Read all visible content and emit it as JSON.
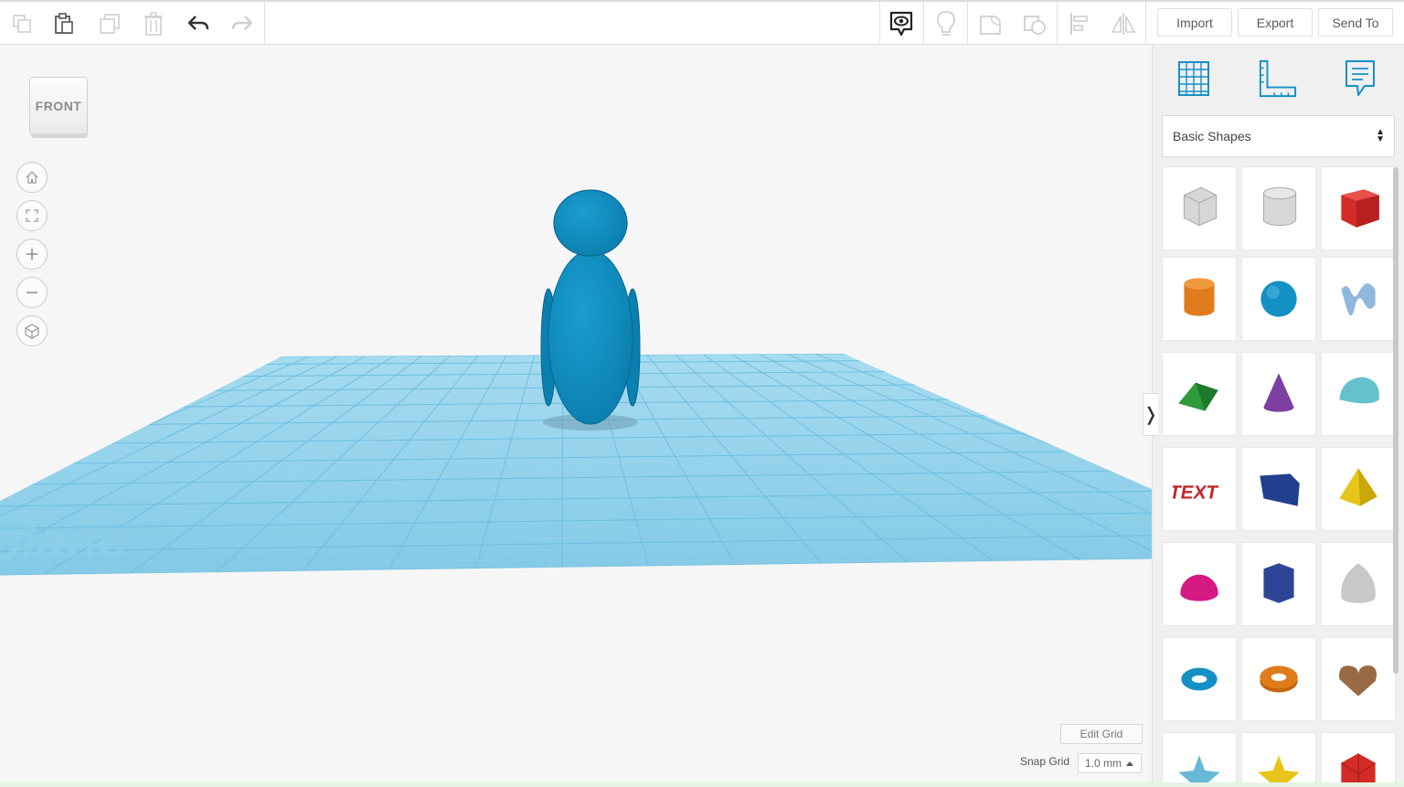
{
  "toolbar": {
    "buttons": [
      {
        "name": "copy",
        "icon": "copy-icon"
      },
      {
        "name": "paste",
        "icon": "paste-icon"
      },
      {
        "name": "duplicate",
        "icon": "duplicate-icon"
      },
      {
        "name": "delete",
        "icon": "trash-icon"
      },
      {
        "name": "undo",
        "icon": "undo-icon"
      },
      {
        "name": "redo",
        "icon": "redo-icon"
      }
    ],
    "view_tools": [
      "show-all-icon",
      "lightbulb-icon",
      "group-icon",
      "ungroup-icon",
      "align-icon",
      "mirror-icon"
    ],
    "import_label": "Import",
    "export_label": "Export",
    "send_to_label": "Send To"
  },
  "viewcube": {
    "face_label": "FRONT"
  },
  "navigation": [
    "home-icon",
    "fit-view-icon",
    "zoom-in-icon",
    "zoom-out-icon",
    "perspective-icon"
  ],
  "workplane": {
    "watermark": "Workplane",
    "grid_color": "#5bb8dc",
    "object_color": "#0e8fc2"
  },
  "grid_controls": {
    "edit_grid_label": "Edit Grid",
    "snap_grid_label": "Snap Grid",
    "snap_value": "1.0 mm"
  },
  "panel": {
    "tabs": [
      "workplane-grid-icon",
      "ruler-icon",
      "notes-icon"
    ],
    "library": "Basic Shapes",
    "shapes": [
      {
        "name": "box-hole",
        "color": "#b8b8b8"
      },
      {
        "name": "cylinder-hole",
        "color": "#b8b8b8"
      },
      {
        "name": "box",
        "color": "#d32c27"
      },
      {
        "name": "cylinder",
        "color": "#e07c1c"
      },
      {
        "name": "sphere",
        "color": "#1391c4"
      },
      {
        "name": "scribble",
        "color": "#8fb9dc"
      },
      {
        "name": "roof",
        "color": "#2f9a3c"
      },
      {
        "name": "cone",
        "color": "#7c3fa0"
      },
      {
        "name": "round-roof",
        "color": "#66c1cf"
      },
      {
        "name": "text",
        "color": "#c1272d"
      },
      {
        "name": "wedge",
        "color": "#23408f"
      },
      {
        "name": "pyramid",
        "color": "#e7c51a"
      },
      {
        "name": "half-sphere",
        "color": "#d61a84"
      },
      {
        "name": "polygon",
        "color": "#2d4596"
      },
      {
        "name": "paraboloid",
        "color": "#c8c8c8"
      },
      {
        "name": "torus",
        "color": "#1391c4"
      },
      {
        "name": "tube",
        "color": "#e07c1c"
      },
      {
        "name": "heart",
        "color": "#9a6a45"
      },
      {
        "name": "star",
        "color": "#66b9d6"
      },
      {
        "name": "star-yellow",
        "color": "#e7c51a"
      },
      {
        "name": "icosahedron",
        "color": "#d32c27"
      }
    ]
  }
}
